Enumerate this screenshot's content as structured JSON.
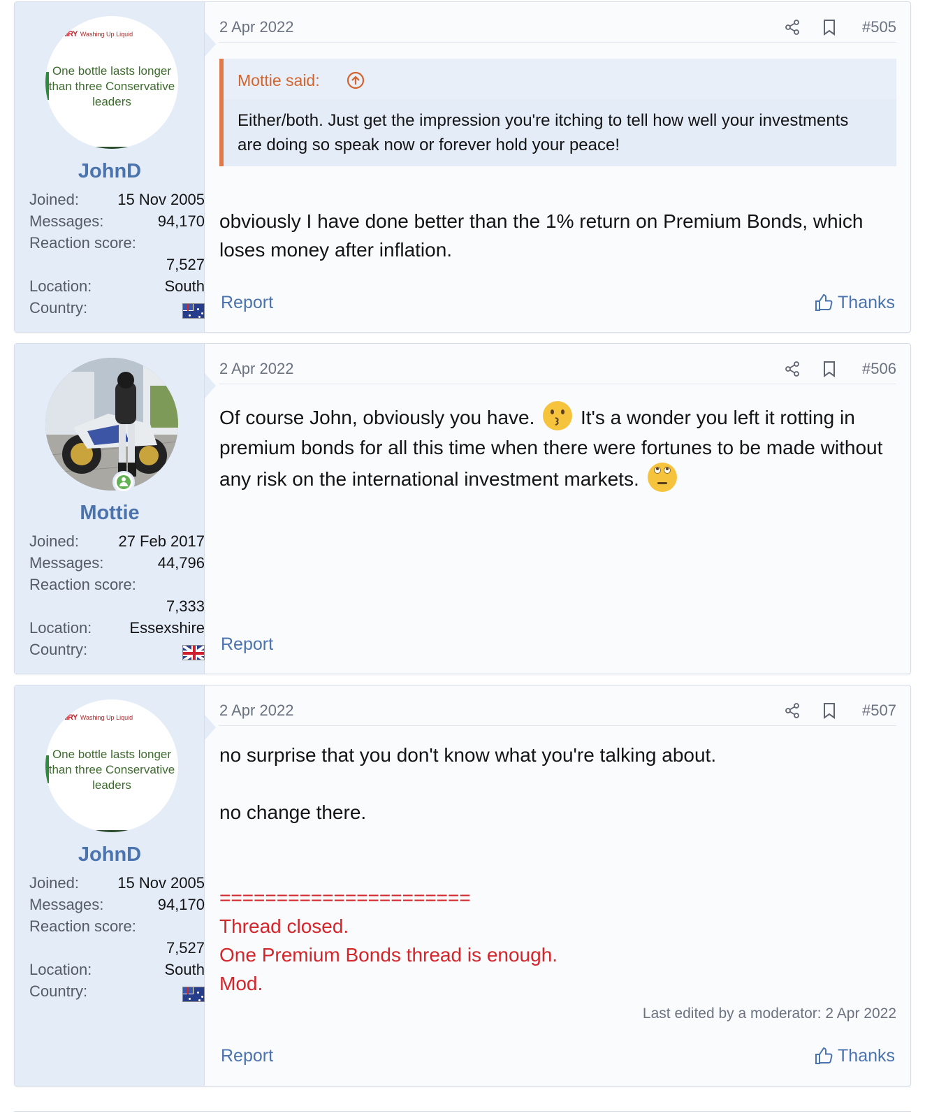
{
  "posts": [
    {
      "user": {
        "avatar_brand": "AIRY",
        "avatar_brand_sub": "Washing Up Liquid",
        "avatar_slogan": "One bottle lasts longer than three Conservative leaders",
        "username": "JohnD",
        "joined_label": "Joined:",
        "joined": "15 Nov 2005",
        "messages_label": "Messages:",
        "messages": "94,170",
        "reaction_label": "Reaction score:",
        "reaction": "7,527",
        "location_label": "Location:",
        "location": "South",
        "country_label": "Country:",
        "country_flag": "australia-flag"
      },
      "date": "2 Apr 2022",
      "number": "#505",
      "quote": {
        "author": "Mottie said:",
        "text": "Either/both. Just get the impression you're itching to tell how well your investments are doing so speak now or forever hold your peace!"
      },
      "body": "obviously I have done better than the 1% return on Premium Bonds, which loses money after inflation.",
      "report": "Report",
      "thanks": "Thanks"
    },
    {
      "user": {
        "username": "Mottie",
        "joined_label": "Joined:",
        "joined": "27 Feb 2017",
        "messages_label": "Messages:",
        "messages": "44,796",
        "reaction_label": "Reaction score:",
        "reaction": "7,333",
        "location_label": "Location:",
        "location": "Essexshire",
        "country_label": "Country:",
        "country_flag": "uk-flag"
      },
      "date": "2 Apr 2022",
      "number": "#506",
      "body_parts": [
        "Of course John, obviously you have.",
        "It's a wonder you left it rotting in premium bonds for all this time when there were fortunes to be made without any risk on the international investment markets."
      ],
      "report": "Report"
    },
    {
      "user": {
        "avatar_brand": "AIRY",
        "avatar_brand_sub": "Washing Up Liquid",
        "avatar_slogan": "One bottle lasts longer than three Conservative leaders",
        "username": "JohnD",
        "joined_label": "Joined:",
        "joined": "15 Nov 2005",
        "messages_label": "Messages:",
        "messages": "94,170",
        "reaction_label": "Reaction score:",
        "reaction": "7,527",
        "location_label": "Location:",
        "location": "South",
        "country_label": "Country:",
        "country_flag": "australia-flag"
      },
      "date": "2 Apr 2022",
      "number": "#507",
      "body_lines": [
        "no surprise that you don't know what you're talking about.",
        "no change there."
      ],
      "mod_lines": [
        "======================",
        "Thread closed.",
        "One Premium Bonds thread is enough.",
        "Mod."
      ],
      "edited": "Last edited by a moderator: 2 Apr 2022",
      "report": "Report",
      "thanks": "Thanks"
    }
  ],
  "colors": {
    "username": "#4b73ad",
    "quote_accent": "#e07a4a",
    "mod_red": "#d3262b",
    "user_panel": "#e4ecf8"
  }
}
